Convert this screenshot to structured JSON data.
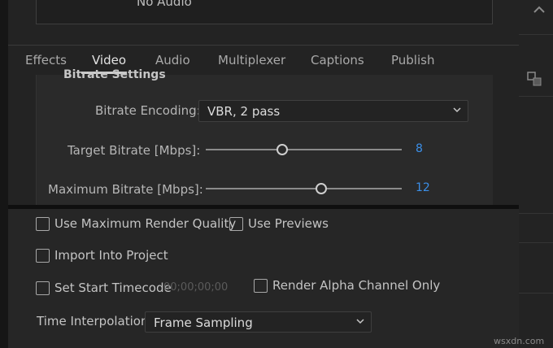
{
  "top": {
    "audio_label": "No Audio"
  },
  "tabs": [
    {
      "label": "Effects"
    },
    {
      "label": "Video"
    },
    {
      "label": "Audio"
    },
    {
      "label": "Multiplexer"
    },
    {
      "label": "Captions"
    },
    {
      "label": "Publish"
    }
  ],
  "active_tab": "Video",
  "bitrate": {
    "section_title": "Bitrate Settings",
    "encoding_label": "Bitrate Encoding:",
    "encoding_value": "VBR, 2 pass",
    "target_label": "Target Bitrate [Mbps]:",
    "target_value": "8",
    "target_fraction": 0.39,
    "max_label": "Maximum Bitrate [Mbps]:",
    "max_value": "12",
    "max_fraction": 0.59
  },
  "options": {
    "max_render_quality": "Use Maximum Render Quality",
    "use_previews": "Use Previews",
    "import_into_project": "Import Into Project",
    "set_start_timecode": "Set Start Timecode",
    "timecode_value": "00;00;00;00",
    "render_alpha": "Render Alpha Channel Only",
    "time_interp_label": "Time Interpolation:",
    "time_interp_value": "Frame Sampling"
  },
  "colors": {
    "accent_value": "#3b8fe8",
    "panel_bg": "#262626"
  },
  "watermark": "wsxdn.com"
}
